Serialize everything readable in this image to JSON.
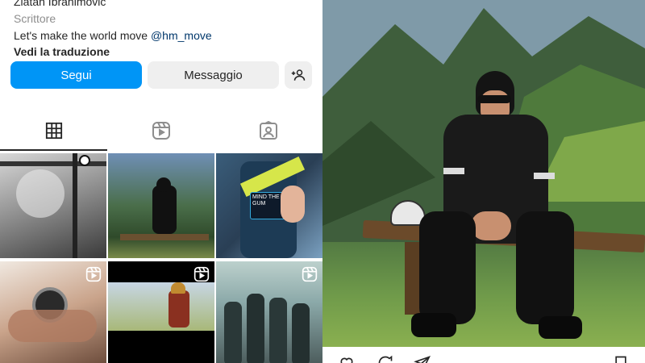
{
  "profile": {
    "name": "Zlatan Ibrahimovic",
    "category": "Scrittore",
    "bio_text": "Let's make the world move ",
    "bio_mention": "@hm_move",
    "translate_label": "Vedi la traduzione"
  },
  "buttons": {
    "follow_label": "Segui",
    "message_label": "Messaggio"
  },
  "tabs": [
    {
      "name": "grid",
      "icon": "grid-icon",
      "active": true
    },
    {
      "name": "reels",
      "icon": "reels-icon",
      "active": false
    },
    {
      "name": "tagged",
      "icon": "tagged-icon",
      "active": false
    }
  ],
  "posts": [
    {
      "type": "photo"
    },
    {
      "type": "photo"
    },
    {
      "type": "photo",
      "caption": "MIND THE GUM"
    },
    {
      "type": "reel"
    },
    {
      "type": "reel"
    },
    {
      "type": "reel"
    }
  ],
  "colors": {
    "accent": "#0095f6",
    "text": "#262626",
    "secondary": "#8e8e8e",
    "button_bg": "#efefef"
  }
}
